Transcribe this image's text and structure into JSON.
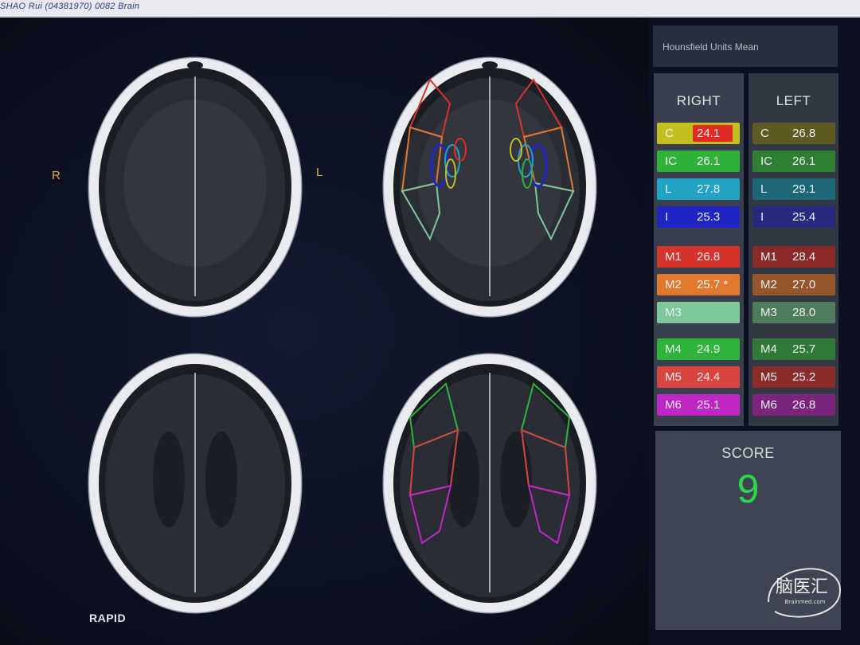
{
  "window": {
    "title": "SHAO Rui (04381970) 0082 Brain"
  },
  "viewer": {
    "orient_right": "R",
    "orient_left": "L",
    "footer": "RAPID"
  },
  "hu_panel": {
    "title": "Hounsfield Units Mean"
  },
  "right_panel": {
    "header": "RIGHT",
    "regions": [
      {
        "label": "C",
        "value": "24.1",
        "color": "#c3bf1e",
        "flagged": true
      },
      {
        "label": "IC",
        "value": "26.1",
        "color": "#2fb13a",
        "flagged": false
      },
      {
        "label": "L",
        "value": "27.8",
        "color": "#20a4c6",
        "flagged": false
      },
      {
        "label": "I",
        "value": "25.3",
        "color": "#1f25c2",
        "flagged": false
      },
      {
        "label": "M1",
        "value": "26.8",
        "color": "#d8332b",
        "flagged": false
      },
      {
        "label": "M2",
        "value": "25.7 *",
        "color": "#e0782e",
        "flagged": false
      },
      {
        "label": "M3",
        "value": "",
        "color": "#7ec79a",
        "flagged": false
      },
      {
        "label": "M4",
        "value": "24.9",
        "color": "#2eb43a",
        "flagged": false
      },
      {
        "label": "M5",
        "value": "24.4",
        "color": "#d9443f",
        "flagged": false
      },
      {
        "label": "M6",
        "value": "25.1",
        "color": "#c025c6",
        "flagged": false
      }
    ]
  },
  "left_panel": {
    "header": "LEFT",
    "regions": [
      {
        "label": "C",
        "value": "26.8",
        "color": "#5f5a22"
      },
      {
        "label": "IC",
        "value": "26.1",
        "color": "#2f7f33"
      },
      {
        "label": "L",
        "value": "29.1",
        "color": "#1c6777"
      },
      {
        "label": "I",
        "value": "25.4",
        "color": "#262a7e"
      },
      {
        "label": "M1",
        "value": "28.4",
        "color": "#8a2a28"
      },
      {
        "label": "M2",
        "value": "27.0",
        "color": "#94562a"
      },
      {
        "label": "M3",
        "value": "28.0",
        "color": "#4f7d5c"
      },
      {
        "label": "M4",
        "value": "25.7",
        "color": "#2f7a36"
      },
      {
        "label": "M5",
        "value": "25.2",
        "color": "#8a2c2a"
      },
      {
        "label": "M6",
        "value": "26.8",
        "color": "#7c237e"
      }
    ]
  },
  "score": {
    "label": "SCORE",
    "value": "9"
  },
  "watermark": {
    "text": "脑医汇",
    "subtext": "Brainmed.com"
  },
  "colors": {
    "score": "#2cd64f",
    "flag": "#e12a24",
    "orientation": "#e0a84a"
  }
}
